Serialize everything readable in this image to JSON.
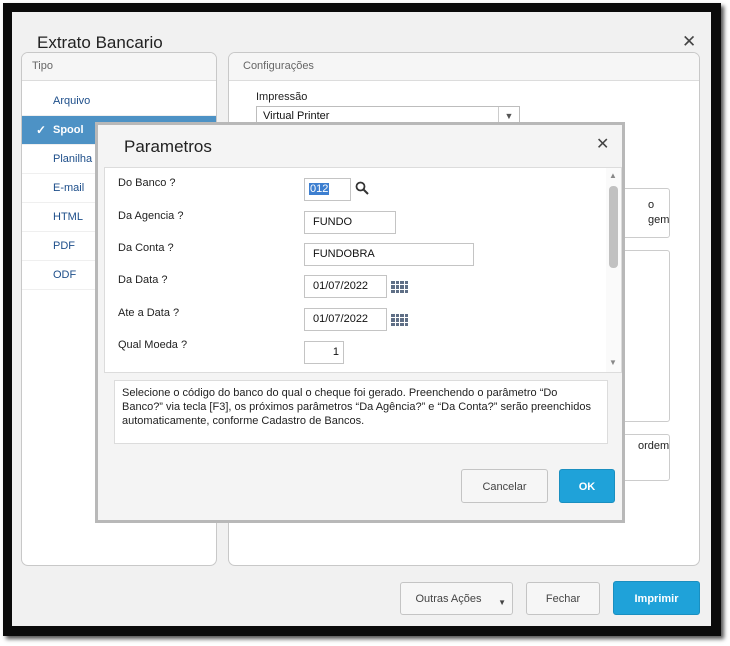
{
  "window": {
    "title": "Extrato Bancario",
    "close_glyph": "✕"
  },
  "tipo": {
    "header": "Tipo",
    "items": [
      {
        "label": "Arquivo"
      },
      {
        "label": "Spool",
        "selected": true
      },
      {
        "label": "Planilha"
      },
      {
        "label": "E-mail"
      },
      {
        "label": "HTML"
      },
      {
        "label": "PDF"
      },
      {
        "label": "ODF"
      }
    ]
  },
  "config": {
    "header": "Configurações",
    "impressao_label": "Impressão",
    "impressao_value": "Virtual Printer",
    "partial_text_1": "o",
    "partial_text_2": "gem",
    "partial_text_3": "ordem"
  },
  "footer": {
    "outras_acoes": "Outras Ações",
    "fechar": "Fechar",
    "imprimir": "Imprimir"
  },
  "dialog": {
    "title": "Parametros",
    "params": [
      {
        "label": "Do Banco ?",
        "value": "012"
      },
      {
        "label": "Da Agencia ?",
        "value": "FUNDO"
      },
      {
        "label": "Da Conta ?",
        "value": "FUNDOBRA"
      },
      {
        "label": "Da Data ?",
        "value": "01/07/2022"
      },
      {
        "label": "Ate a Data ?",
        "value": "01/07/2022"
      },
      {
        "label": "Qual Moeda ?",
        "value": "1"
      }
    ],
    "help_text": "Selecione o código do banco do qual o cheque foi gerado. Preenchendo o parâmetro “Do Banco?” via tecla [F3], os próximos parâmetros “Da Agência?” e “Da Conta?” serão preenchidos automaticamente, conforme Cadastro de Bancos.",
    "cancel_label": "Cancelar",
    "ok_label": "OK"
  },
  "colors": {
    "accent": "#1fa2d9",
    "selected": "#4d92c5",
    "link": "#1d4e8a"
  }
}
